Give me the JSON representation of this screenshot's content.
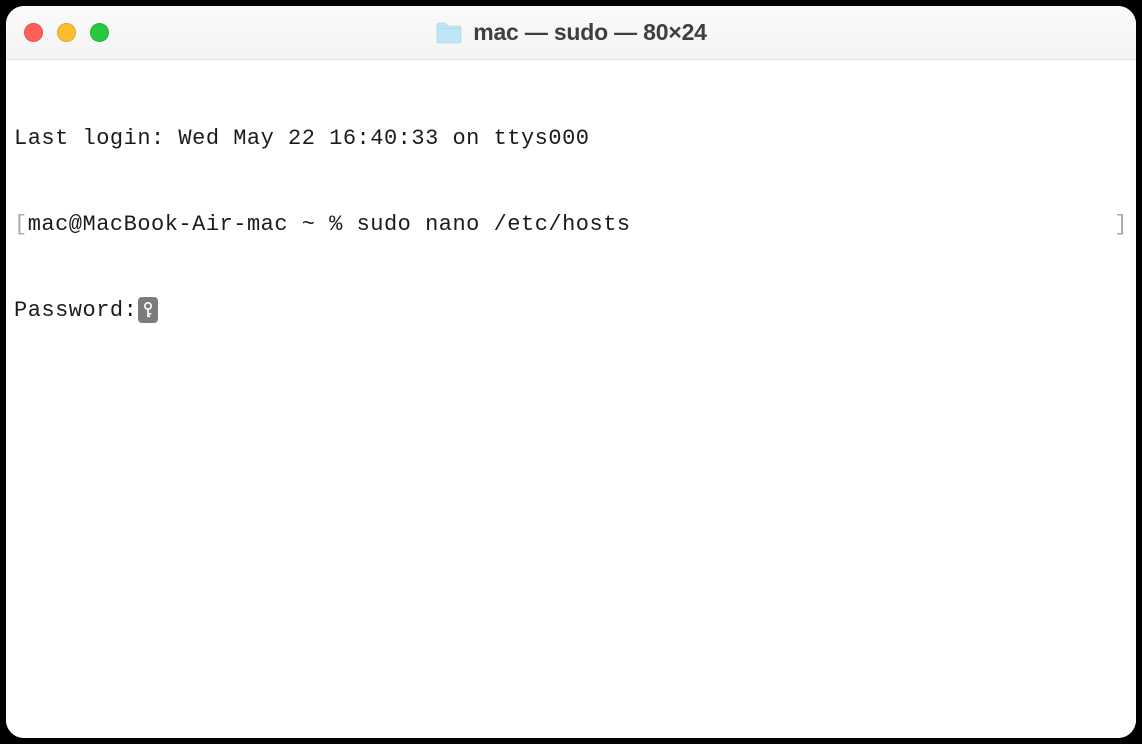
{
  "window": {
    "title": "mac — sudo — 80×24"
  },
  "terminal": {
    "line1": "Last login: Wed May 22 16:40:33 on ttys000",
    "bracket_left": "[",
    "bracket_right": "]",
    "prompt_user_host": "mac@MacBook-Air-mac ~ % ",
    "command": "sudo nano /etc/hosts",
    "password_label": "Password:"
  },
  "icons": {
    "folder": "folder-icon",
    "key": "key-icon"
  }
}
